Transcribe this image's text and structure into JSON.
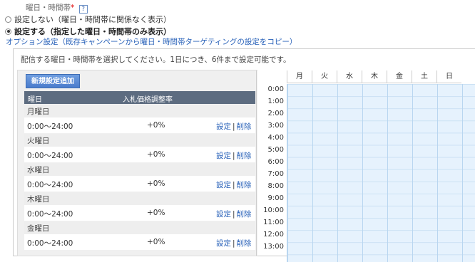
{
  "field": {
    "label": "曜日・時間帯",
    "required_mark": "*",
    "help": "?"
  },
  "radios": [
    {
      "label": "設定しない（曜日・時間帯に関係なく表示）",
      "checked": false
    },
    {
      "label": "設定する（指定した曜日・時間帯のみ表示）",
      "checked": true
    }
  ],
  "option_link": "オプション設定（既存キャンペーンから曜日・時間帯ターゲティングの設定をコピー）",
  "panel": {
    "message": "配信する曜日・時間帯を選択してください。1日につき、6件まで設定可能です。",
    "add_button": "新規設定追加",
    "columns": {
      "day": "曜日",
      "rate": "入札価格調整率"
    },
    "days": [
      {
        "name": "月曜日",
        "time": "0:00〜24:00",
        "rate": "+0%"
      },
      {
        "name": "火曜日",
        "time": "0:00〜24:00",
        "rate": "+0%"
      },
      {
        "name": "水曜日",
        "time": "0:00〜24:00",
        "rate": "+0%"
      },
      {
        "name": "木曜日",
        "time": "0:00〜24:00",
        "rate": "+0%"
      },
      {
        "name": "金曜日",
        "time": "0:00〜24:00",
        "rate": "+0%"
      }
    ],
    "action_set": "設定",
    "action_sep": "|",
    "action_delete": "削除"
  },
  "schedule": {
    "days": [
      "月",
      "火",
      "水",
      "木",
      "金",
      "土",
      "日"
    ],
    "hours": [
      "0:00",
      "1:00",
      "2:00",
      "3:00",
      "4:00",
      "5:00",
      "6:00",
      "7:00",
      "8:00",
      "9:00",
      "10:00",
      "11:00",
      "12:00",
      "13:00"
    ],
    "cell_color": "#e6f2fd"
  }
}
